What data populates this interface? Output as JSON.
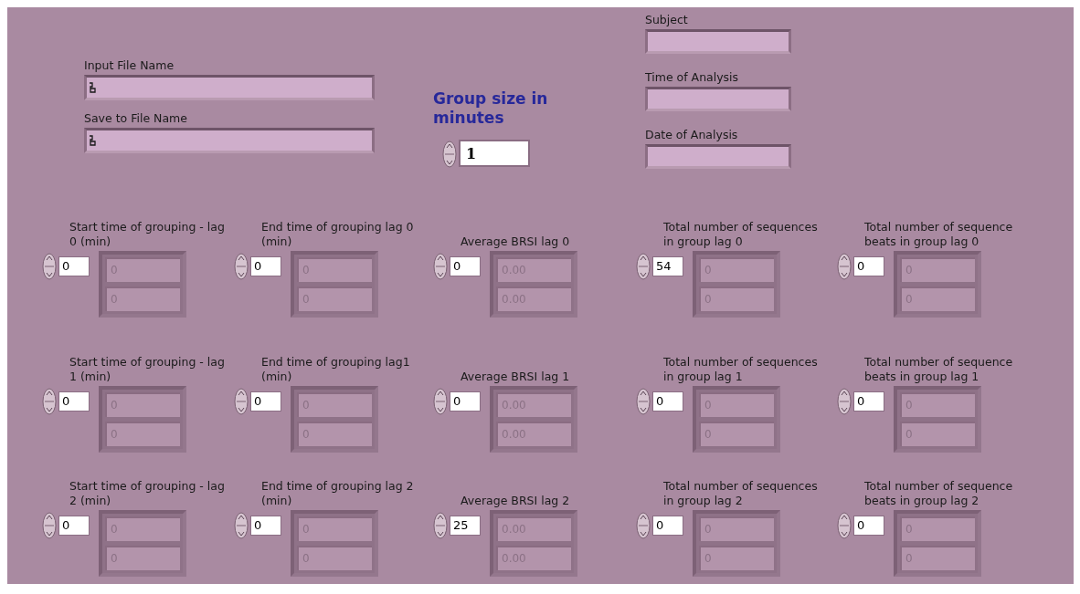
{
  "file_fields": [
    {
      "label": "Input File Name"
    },
    {
      "label": "Save to File Name"
    }
  ],
  "group_size": {
    "label": "Group size in minutes",
    "value": "1"
  },
  "info_fields": [
    {
      "label": "Subject"
    },
    {
      "label": "Time of Analysis"
    },
    {
      "label": "Date of Analysis"
    }
  ],
  "array_rows": [
    [
      {
        "label": "Start time of grouping - lag 0 (min)",
        "index": "0",
        "elements": [
          "0",
          "0"
        ]
      },
      {
        "label": "End time of grouping lag 0 (min)",
        "index": "0",
        "elements": [
          "0",
          "0"
        ]
      },
      {
        "label": "Average BRSI lag 0",
        "index": "0",
        "elements": [
          "0.00",
          "0.00"
        ]
      },
      {
        "label": "Total number of sequences in group lag 0",
        "index": "54",
        "elements": [
          "0",
          "0"
        ]
      },
      {
        "label": "Total number of sequence beats in group lag 0",
        "index": "0",
        "elements": [
          "0",
          "0"
        ]
      }
    ],
    [
      {
        "label": "Start time of grouping - lag 1 (min)",
        "index": "0",
        "elements": [
          "0",
          "0"
        ]
      },
      {
        "label": "End time of grouping lag1 (min)",
        "index": "0",
        "elements": [
          "0",
          "0"
        ]
      },
      {
        "label": "Average BRSI lag 1",
        "index": "0",
        "elements": [
          "0.00",
          "0.00"
        ]
      },
      {
        "label": "Total number of sequences in group lag 1",
        "index": "0",
        "elements": [
          "0",
          "0"
        ]
      },
      {
        "label": "Total number of sequence beats in group lag 1",
        "index": "0",
        "elements": [
          "0",
          "0"
        ]
      }
    ],
    [
      {
        "label": "Start time of grouping - lag 2 (min)",
        "index": "0",
        "elements": [
          "0",
          "0"
        ]
      },
      {
        "label": "End time of grouping lag 2 (min)",
        "index": "0",
        "elements": [
          "0",
          "0"
        ]
      },
      {
        "label": "Average BRSI lag 2",
        "index": "25",
        "elements": [
          "0.00",
          "0.00"
        ]
      },
      {
        "label": "Total number of sequences in group lag 2",
        "index": "0",
        "elements": [
          "0",
          "0"
        ]
      },
      {
        "label": "Total number of sequence beats in group lag 2",
        "index": "0",
        "elements": [
          "0",
          "0"
        ]
      }
    ]
  ]
}
